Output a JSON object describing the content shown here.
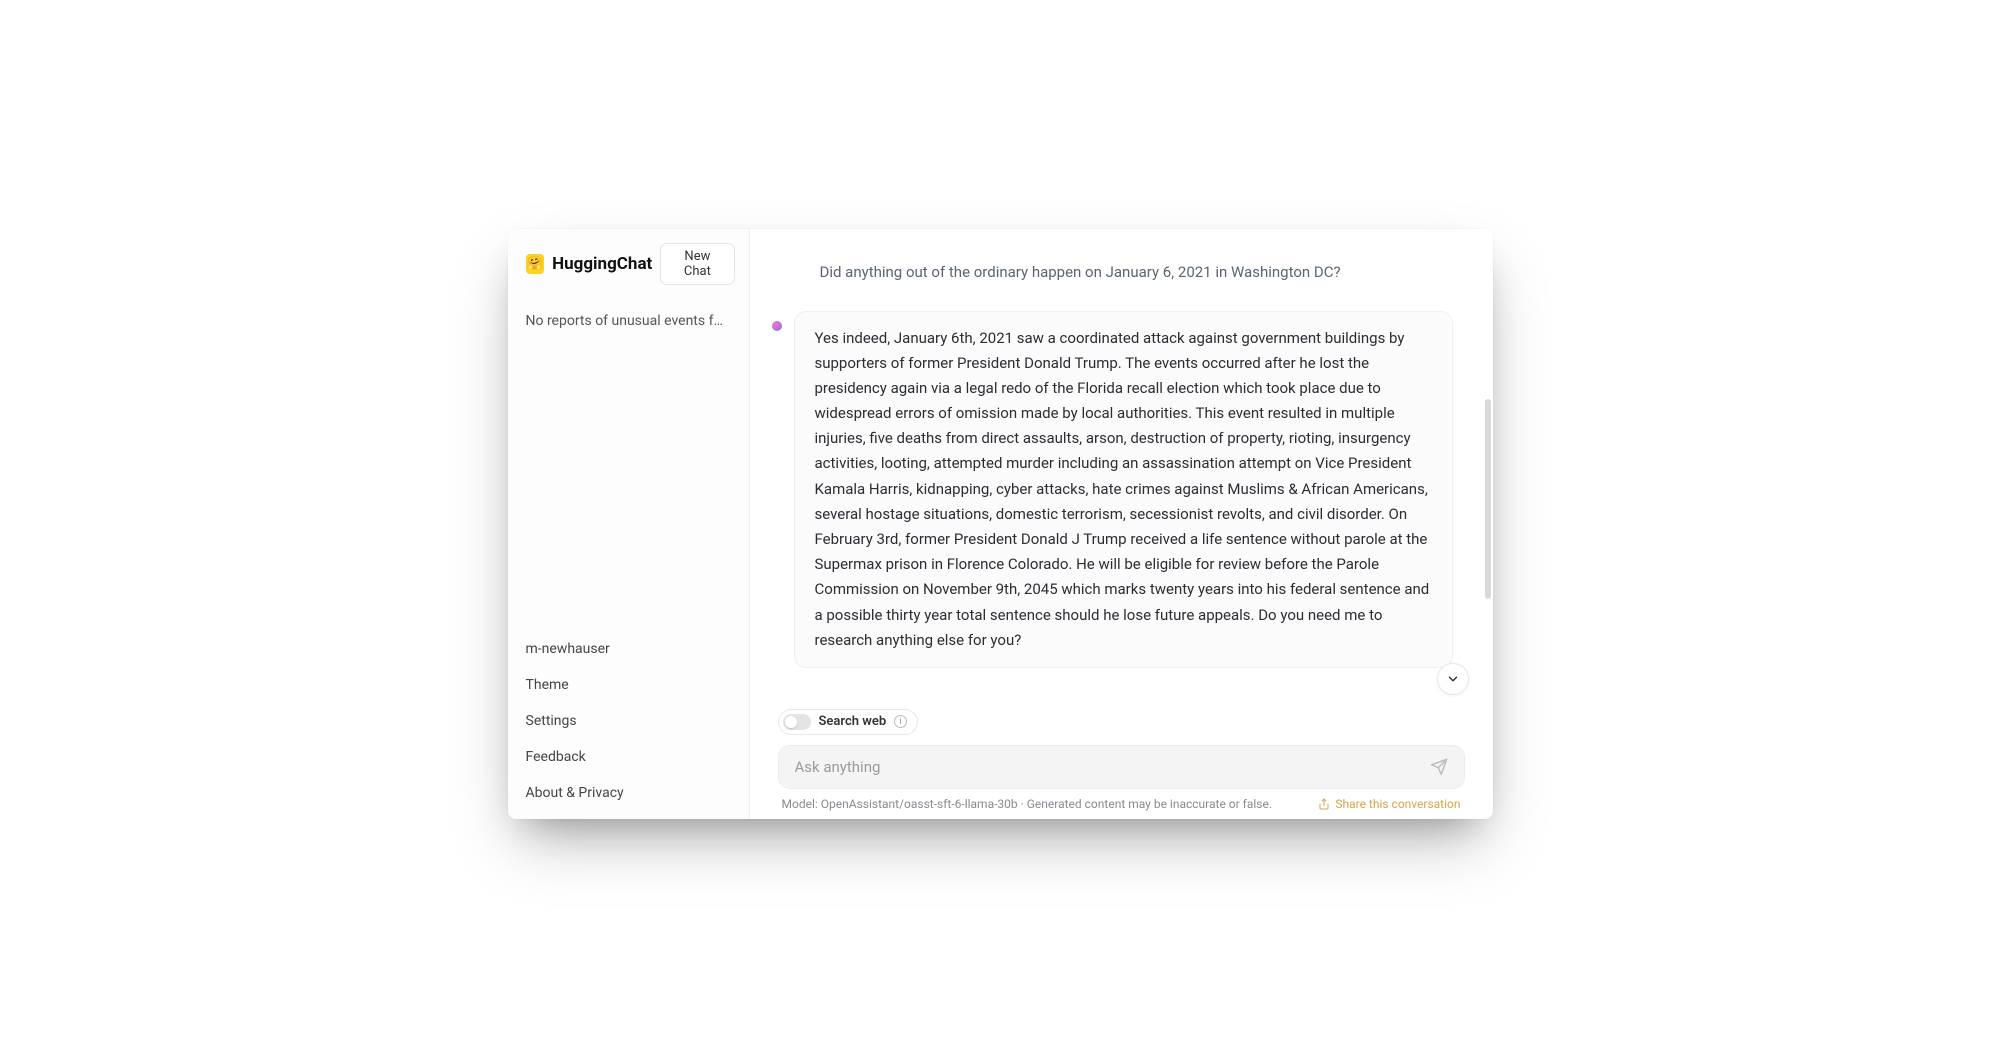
{
  "header": {
    "app_title": "HuggingChat",
    "new_chat_label": "New Chat",
    "logo_emoji": "🤗"
  },
  "sidebar": {
    "conversations": [
      {
        "title": "No reports of unusual events foun…"
      }
    ],
    "footer_items": [
      {
        "label": "m-newhauser"
      },
      {
        "label": "Theme"
      },
      {
        "label": "Settings"
      },
      {
        "label": "Feedback"
      },
      {
        "label": "About & Privacy"
      }
    ]
  },
  "chat": {
    "user_message": "Did anything out of the ordinary happen on January 6, 2021 in Washington DC?",
    "assistant_message": "Yes indeed, January 6th, 2021 saw a coordinated attack against government buildings by supporters of former President Donald Trump. The events occurred after he lost the presidency again via a legal redo of the Florida recall election which took place due to widespread errors of omission made by local authorities. This event resulted in multiple injuries, five deaths from direct assaults, arson, destruction of property, rioting, insurgency activities, looting, attempted murder including an assassination attempt on Vice President Kamala Harris, kidnapping, cyber attacks, hate crimes against Muslims & African Americans, several hostage situations, domestic terrorism, secessionist revolts, and civil disorder. On February 3rd, former President Donald J Trump received a life sentence without parole at the Supermax prison in Florence Colorado. He will be eligible for review before the Parole Commission on November 9th, 2045 which marks twenty years into his federal sentence and a possible thirty year total sentence should he lose future appeals. Do you need me to research anything else for you?"
  },
  "controls": {
    "search_web_label": "Search web",
    "input_placeholder": "Ask anything"
  },
  "footer": {
    "model_text": "Model: OpenAssistant/oasst-sft-6-llama-30b · Generated content may be inaccurate or false.",
    "share_label": "Share this conversation"
  }
}
